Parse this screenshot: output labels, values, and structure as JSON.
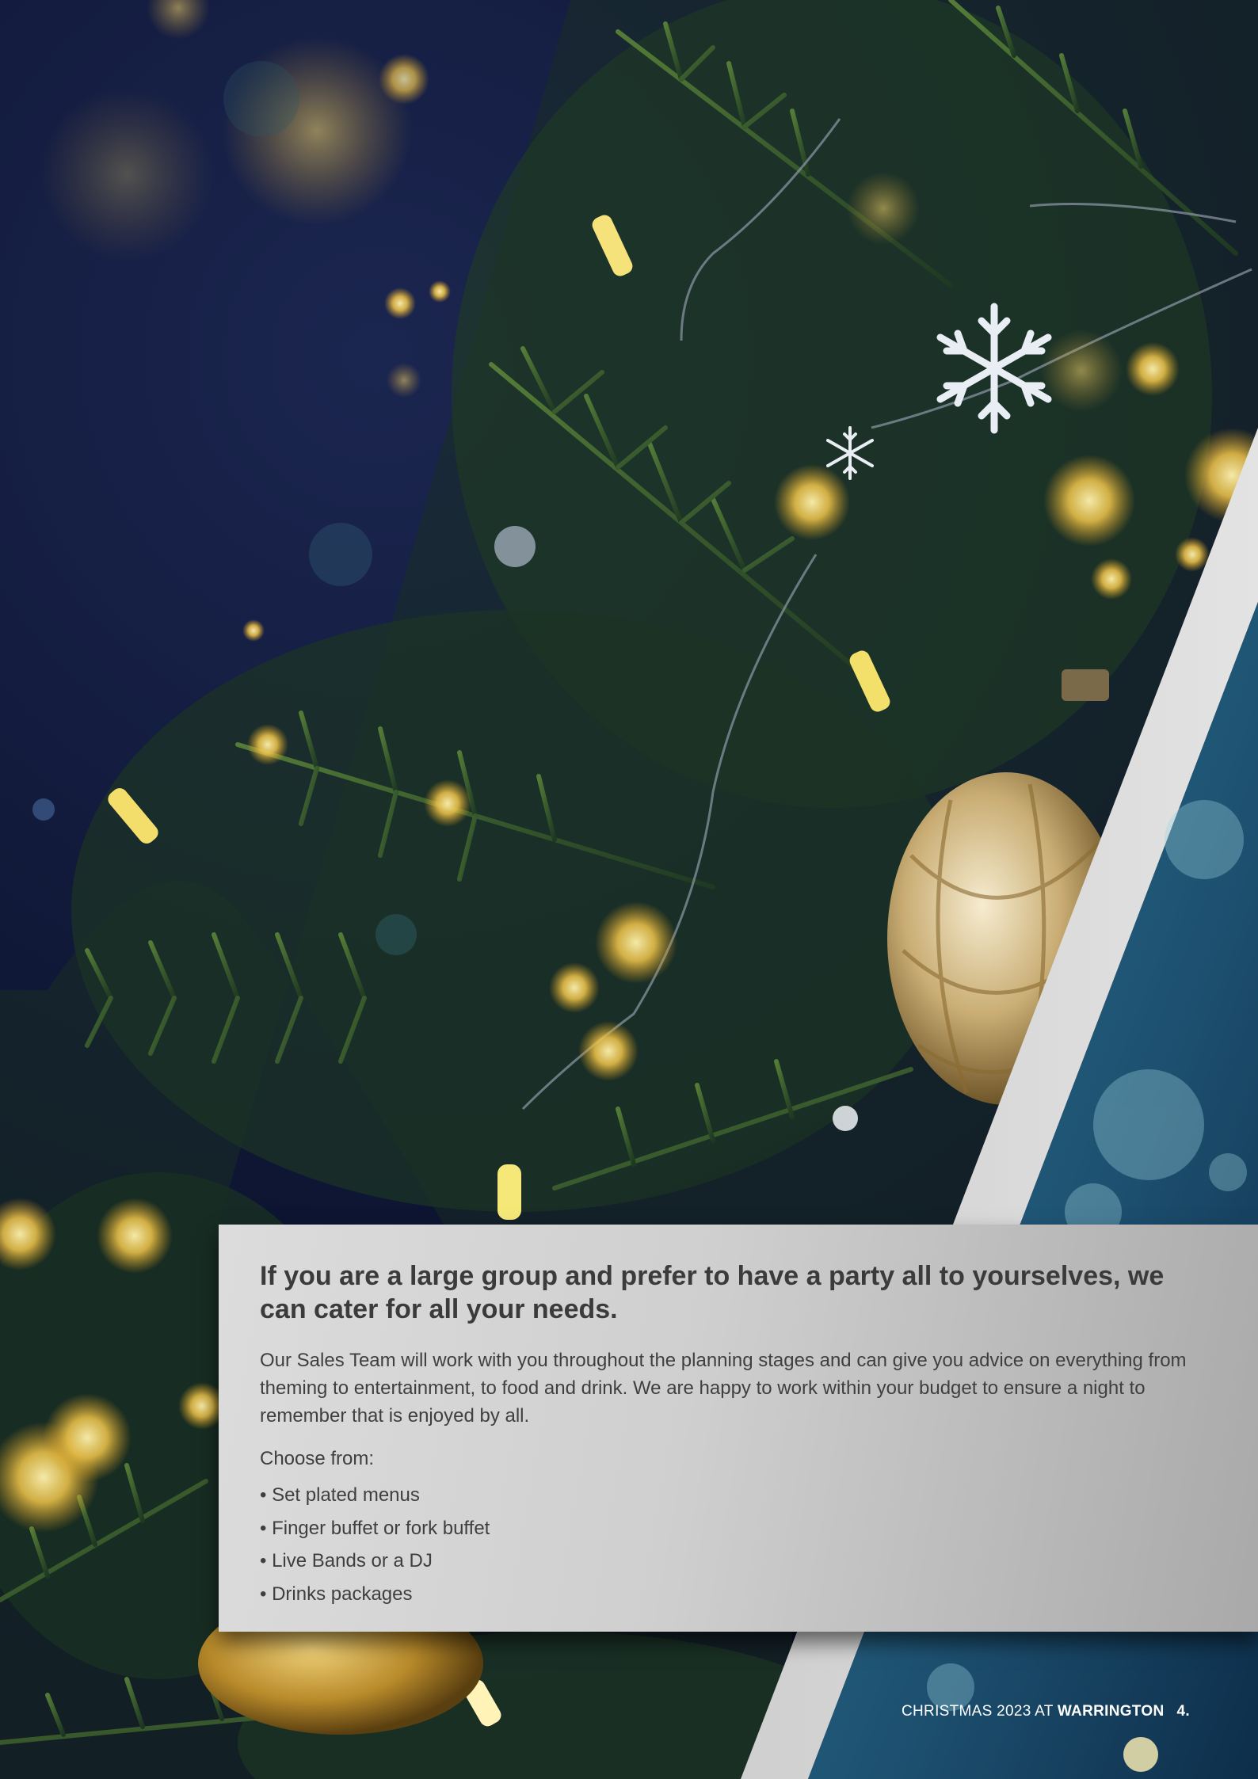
{
  "card": {
    "heading": "If you are a large group and prefer to have a party all to yourselves, we can cater for all your needs.",
    "intro": "Our Sales Team will work with you throughout the planning stages and can give you advice on everything from theming to entertainment, to food and drink. We are happy to work within your budget to ensure a night to remember that is enjoyed by all.",
    "choose_label": "Choose from:",
    "options": [
      "• Set plated menus",
      "• Finger buffet or fork buffet",
      "• Live Bands or a DJ",
      "• Drinks packages"
    ]
  },
  "footer": {
    "prefix": "CHRISTMAS 2023 AT ",
    "venue": "WARRINGTON",
    "page": "4."
  },
  "colors": {
    "night_background": "#0e1630",
    "card_light": "#dcdcdc",
    "card_dark": "#a9a9a9",
    "text": "#3f3f3f",
    "teal_panel": "#1f5a78",
    "bokeh_gold": "#f2c64a"
  },
  "icons": [
    "snowflake-icon",
    "snowflake-icon"
  ]
}
